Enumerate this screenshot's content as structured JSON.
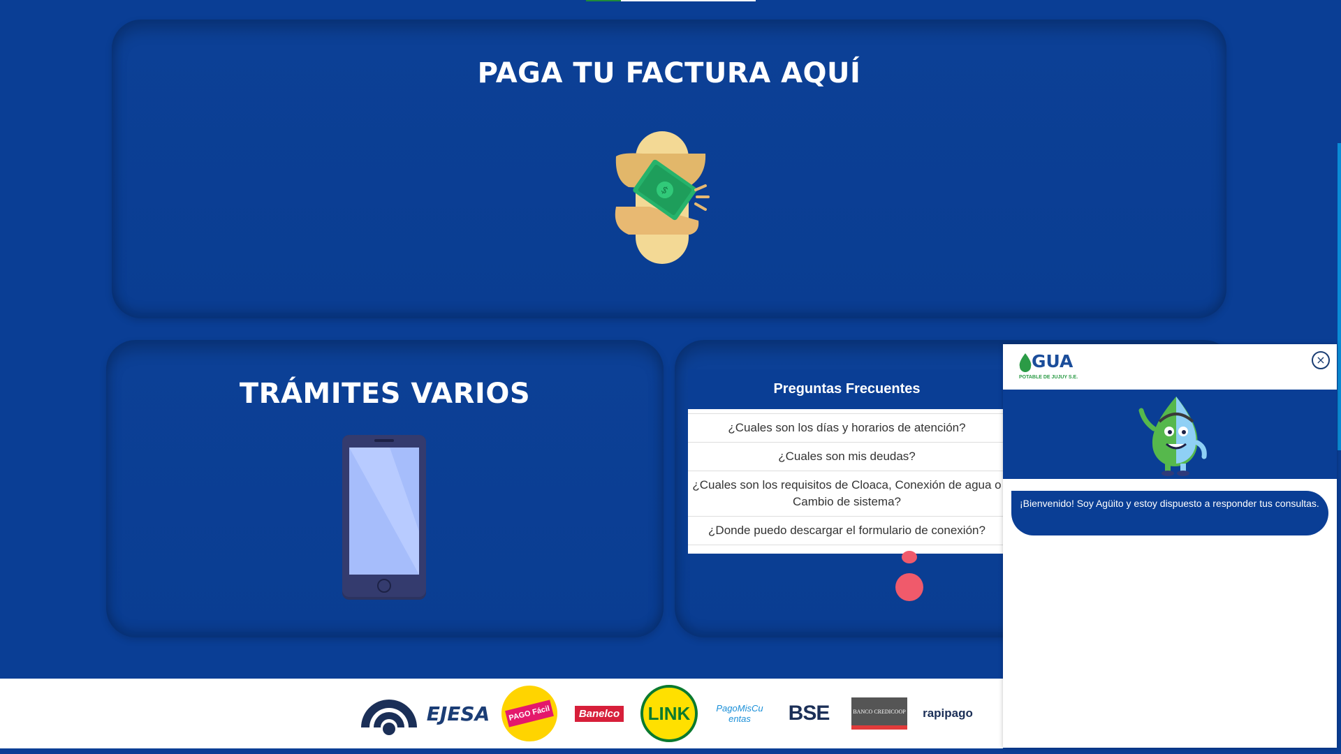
{
  "pay_section": {
    "title": "PAGA TU FACTURA AQUÍ",
    "icon": "money-hand-icon"
  },
  "tramites_section": {
    "title": "TRÁMITES VARIOS",
    "icon": "smartphone-icon"
  },
  "faq": {
    "title": "Preguntas Frecuentes",
    "items": [
      "¿Cuales son los días y horarios de atención?",
      "¿Cuales son mis deudas?",
      "¿Cuales son los requisitos de Cloaca, Conexión de agua o Cambio de sistema?",
      "¿Donde puedo descargar el formulario de conexión?"
    ]
  },
  "partners": [
    {
      "name": "EJESA"
    },
    {
      "name": "PAGO Fácil"
    },
    {
      "name": "Banelco"
    },
    {
      "name": "LINK"
    },
    {
      "name": "PagoMisCuentas"
    },
    {
      "name": "BSE"
    },
    {
      "name": "BANCO CREDICOOP"
    },
    {
      "name": "rapipago"
    }
  ],
  "chat": {
    "brand": "GUA",
    "brand_sub": "POTABLE DE JUJUY S.E.",
    "close_symbol": "×",
    "welcome_message": "¡Bienvenido! Soy Agüito y estoy dispuesto a responder tus consultas."
  },
  "colors": {
    "background": "#0a3e95",
    "accent_green": "#1f8a3a",
    "dot_red": "#f05a6b",
    "scrollbar": "#0a8bd6"
  }
}
